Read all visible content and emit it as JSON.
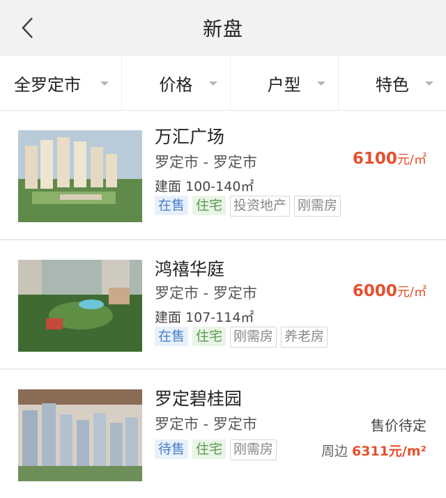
{
  "header": {
    "title": "新盘"
  },
  "filters": [
    {
      "label": "全罗定市"
    },
    {
      "label": "价格"
    },
    {
      "label": "户型"
    },
    {
      "label": "特色"
    }
  ],
  "listings": [
    {
      "name": "万汇广场",
      "location": "罗定市 - 罗定市",
      "area": "建面 100-140㎡",
      "price_value": "6100",
      "price_unit": "元/㎡",
      "tags": [
        "在售",
        "住宅",
        "投资地产",
        "刚需房"
      ]
    },
    {
      "name": "鸿禧华庭",
      "location": "罗定市 - 罗定市",
      "area": "建面 107-114㎡",
      "price_value": "6000",
      "price_unit": "元/㎡",
      "tags": [
        "在售",
        "住宅",
        "刚需房",
        "养老房"
      ]
    },
    {
      "name": "罗定碧桂园",
      "location": "罗定市 - 罗定市",
      "status": "售价待定",
      "nearby_label": "周边",
      "nearby_price": "6311元/m²",
      "tags": [
        "待售",
        "住宅",
        "刚需房"
      ]
    }
  ],
  "colors": {
    "price": "#e4502d",
    "tag_sale": "#4a7fc9",
    "tag_residential": "#5a9a4f"
  }
}
